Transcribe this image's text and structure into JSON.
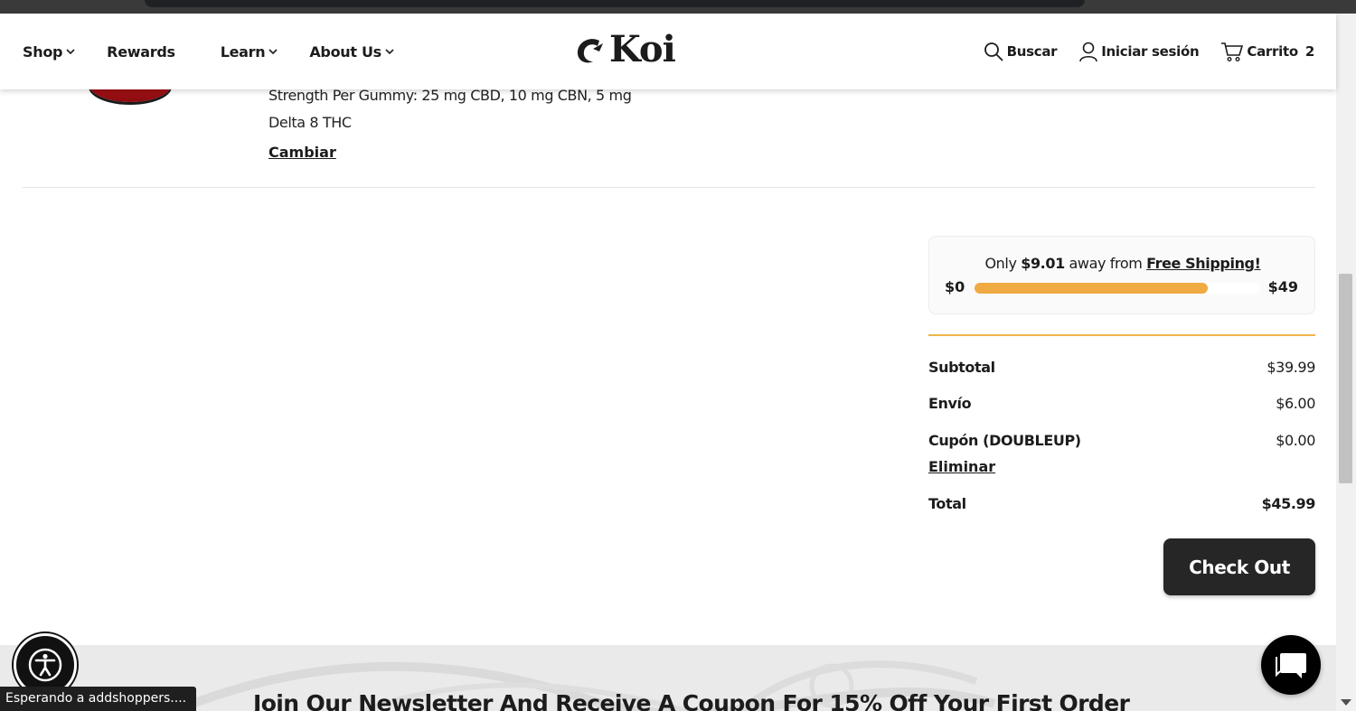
{
  "header": {
    "nav": [
      {
        "label": "Shop",
        "has_dropdown": true
      },
      {
        "label": "Rewards",
        "has_dropdown": false
      },
      {
        "label": "Learn",
        "has_dropdown": true
      },
      {
        "label": "About Us",
        "has_dropdown": true
      }
    ],
    "logo_text": "Koi",
    "search_label": "Buscar",
    "login_label": "Iniciar sesión",
    "cart_label": "Carrito",
    "cart_count": "2"
  },
  "product": {
    "strength_line": "Strength Per Gummy: 25 mg CBD, 10 mg CBN, 5 mg",
    "strength_line_2": "Delta 8 THC",
    "change_label": "Cambiar"
  },
  "shipping": {
    "prefix": "Only ",
    "amount": "$9.01",
    "middle": " away from ",
    "target_label": "Free Shipping!",
    "min_label": "$0",
    "max_label": "$49",
    "progress_fraction": 0.816,
    "bar_color": "#f0aa42"
  },
  "summary": {
    "subtotal_label": "Subtotal",
    "subtotal_value": "$39.99",
    "shipping_label": "Envío",
    "shipping_value": "$6.00",
    "coupon_label": "Cupón (",
    "coupon_code": "DOUBLEUP",
    "coupon_close": ")",
    "coupon_value": "$0.00",
    "remove_label": "Eliminar",
    "total_label": "Total",
    "total_value": "$45.99"
  },
  "checkout_label": "Check Out",
  "newsletter_title": "Join Our Newsletter And Receive A Coupon For 15% Off Your First Order",
  "status_text": "Esperando a addshoppers....",
  "colors": {
    "accent_gold": "#efb54a",
    "dark_button": "#262626"
  }
}
